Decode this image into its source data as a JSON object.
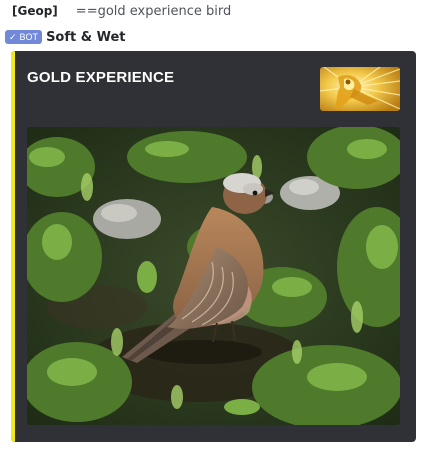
{
  "message": {
    "username": "[Geop]",
    "command": "==gold experience bird"
  },
  "bot": {
    "tag_check": "✓",
    "tag_label": "BOT",
    "name": "Soft & Wet"
  },
  "embed": {
    "accent_color": "#f1ea1a",
    "background_color": "#2f3136",
    "title": "GOLD EXPERIENCE",
    "thumbnail_icon": "gold-experience-stand-thumbnail",
    "image_subject": "bird-photo"
  }
}
